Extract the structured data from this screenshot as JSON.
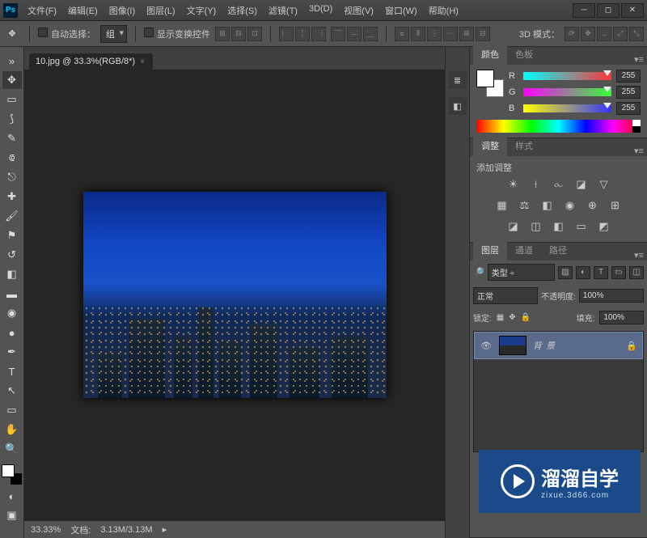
{
  "titlebar": {
    "logo": "Ps"
  },
  "menu": {
    "file": "文件(F)",
    "edit": "编辑(E)",
    "image": "图像(I)",
    "layer": "图层(L)",
    "type": "文字(Y)",
    "select": "选择(S)",
    "filter": "滤镜(T)",
    "d3d": "3D(D)",
    "view": "视图(V)",
    "window": "窗口(W)",
    "help": "帮助(H)"
  },
  "options": {
    "auto_select_label": "自动选择：",
    "auto_select_value": "组",
    "show_transform": "显示变换控件",
    "mode3d_label": "3D 模式："
  },
  "doc": {
    "tab_title": "10.jpg @ 33.3%(RGB/8*)",
    "zoom": "33.33%",
    "status_label": "文档:",
    "status_value": "3.13M/3.13M"
  },
  "panels": {
    "color_tab": "颜色",
    "swatches_tab": "色板",
    "r_label": "R",
    "r_val": "255",
    "g_label": "G",
    "g_val": "255",
    "b_label": "B",
    "b_val": "255",
    "adjust_tab": "调整",
    "styles_tab": "样式",
    "add_adjust": "添加调整",
    "layers_tab": "图层",
    "channels_tab": "通道",
    "paths_tab": "路径",
    "kind_label": "类型",
    "blend_mode": "正常",
    "opacity_label": "不透明度:",
    "opacity_value": "100%",
    "lock_label": "锁定:",
    "fill_label": "填充:",
    "fill_value": "100%",
    "layer_name": "背 景"
  },
  "watermark": {
    "title": "溜溜自学",
    "sub": "zixue.3d66.com"
  }
}
